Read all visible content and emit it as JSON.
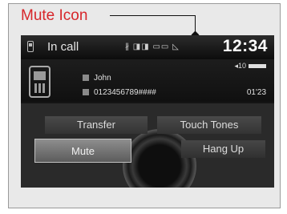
{
  "callout": {
    "label": "Mute Icon"
  },
  "status_bar": {
    "title": "In call",
    "indicators": "∦ ◨◨ ▭▭ ◺",
    "time": "12:34"
  },
  "call_info": {
    "volume_text": "◂10",
    "contact_name": "John",
    "phone_number": "0123456789####",
    "duration": "01'23"
  },
  "buttons": {
    "transfer": "Transfer",
    "touch_tones": "Touch Tones",
    "mute": "Mute",
    "hang_up": "Hang Up"
  }
}
